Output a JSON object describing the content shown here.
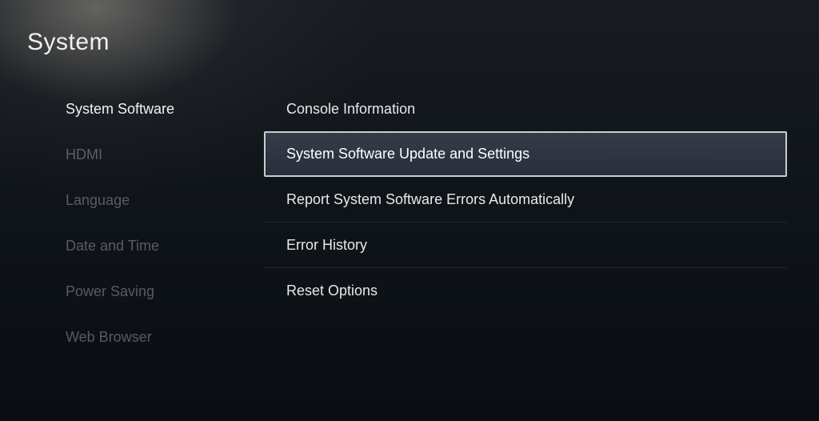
{
  "page": {
    "title": "System"
  },
  "sidebar": {
    "items": [
      {
        "label": "System Software",
        "active": true
      },
      {
        "label": "HDMI",
        "active": false
      },
      {
        "label": "Language",
        "active": false
      },
      {
        "label": "Date and Time",
        "active": false
      },
      {
        "label": "Power Saving",
        "active": false
      },
      {
        "label": "Web Browser",
        "active": false
      }
    ]
  },
  "main": {
    "items": [
      {
        "label": "Console Information",
        "selected": false
      },
      {
        "label": "System Software Update and Settings",
        "selected": true
      },
      {
        "label": "Report System Software Errors Automatically",
        "selected": false
      },
      {
        "label": "Error History",
        "selected": false
      },
      {
        "label": "Reset Options",
        "selected": false
      }
    ]
  }
}
